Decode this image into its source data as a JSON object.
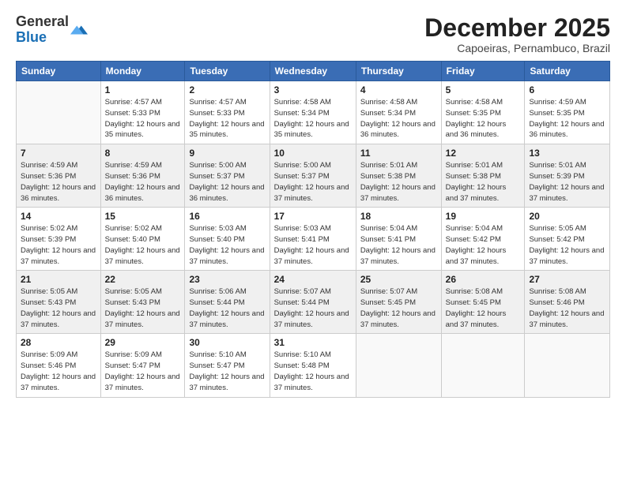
{
  "header": {
    "logo_general": "General",
    "logo_blue": "Blue",
    "month_title": "December 2025",
    "subtitle": "Capoeiras, Pernambuco, Brazil"
  },
  "weekdays": [
    "Sunday",
    "Monday",
    "Tuesday",
    "Wednesday",
    "Thursday",
    "Friday",
    "Saturday"
  ],
  "weeks": [
    [
      {
        "day": "",
        "sunrise": "",
        "sunset": "",
        "daylight": ""
      },
      {
        "day": "1",
        "sunrise": "Sunrise: 4:57 AM",
        "sunset": "Sunset: 5:33 PM",
        "daylight": "Daylight: 12 hours and 35 minutes."
      },
      {
        "day": "2",
        "sunrise": "Sunrise: 4:57 AM",
        "sunset": "Sunset: 5:33 PM",
        "daylight": "Daylight: 12 hours and 35 minutes."
      },
      {
        "day": "3",
        "sunrise": "Sunrise: 4:58 AM",
        "sunset": "Sunset: 5:34 PM",
        "daylight": "Daylight: 12 hours and 35 minutes."
      },
      {
        "day": "4",
        "sunrise": "Sunrise: 4:58 AM",
        "sunset": "Sunset: 5:34 PM",
        "daylight": "Daylight: 12 hours and 36 minutes."
      },
      {
        "day": "5",
        "sunrise": "Sunrise: 4:58 AM",
        "sunset": "Sunset: 5:35 PM",
        "daylight": "Daylight: 12 hours and 36 minutes."
      },
      {
        "day": "6",
        "sunrise": "Sunrise: 4:59 AM",
        "sunset": "Sunset: 5:35 PM",
        "daylight": "Daylight: 12 hours and 36 minutes."
      }
    ],
    [
      {
        "day": "7",
        "sunrise": "Sunrise: 4:59 AM",
        "sunset": "Sunset: 5:36 PM",
        "daylight": "Daylight: 12 hours and 36 minutes."
      },
      {
        "day": "8",
        "sunrise": "Sunrise: 4:59 AM",
        "sunset": "Sunset: 5:36 PM",
        "daylight": "Daylight: 12 hours and 36 minutes."
      },
      {
        "day": "9",
        "sunrise": "Sunrise: 5:00 AM",
        "sunset": "Sunset: 5:37 PM",
        "daylight": "Daylight: 12 hours and 36 minutes."
      },
      {
        "day": "10",
        "sunrise": "Sunrise: 5:00 AM",
        "sunset": "Sunset: 5:37 PM",
        "daylight": "Daylight: 12 hours and 37 minutes."
      },
      {
        "day": "11",
        "sunrise": "Sunrise: 5:01 AM",
        "sunset": "Sunset: 5:38 PM",
        "daylight": "Daylight: 12 hours and 37 minutes."
      },
      {
        "day": "12",
        "sunrise": "Sunrise: 5:01 AM",
        "sunset": "Sunset: 5:38 PM",
        "daylight": "Daylight: 12 hours and 37 minutes."
      },
      {
        "day": "13",
        "sunrise": "Sunrise: 5:01 AM",
        "sunset": "Sunset: 5:39 PM",
        "daylight": "Daylight: 12 hours and 37 minutes."
      }
    ],
    [
      {
        "day": "14",
        "sunrise": "Sunrise: 5:02 AM",
        "sunset": "Sunset: 5:39 PM",
        "daylight": "Daylight: 12 hours and 37 minutes."
      },
      {
        "day": "15",
        "sunrise": "Sunrise: 5:02 AM",
        "sunset": "Sunset: 5:40 PM",
        "daylight": "Daylight: 12 hours and 37 minutes."
      },
      {
        "day": "16",
        "sunrise": "Sunrise: 5:03 AM",
        "sunset": "Sunset: 5:40 PM",
        "daylight": "Daylight: 12 hours and 37 minutes."
      },
      {
        "day": "17",
        "sunrise": "Sunrise: 5:03 AM",
        "sunset": "Sunset: 5:41 PM",
        "daylight": "Daylight: 12 hours and 37 minutes."
      },
      {
        "day": "18",
        "sunrise": "Sunrise: 5:04 AM",
        "sunset": "Sunset: 5:41 PM",
        "daylight": "Daylight: 12 hours and 37 minutes."
      },
      {
        "day": "19",
        "sunrise": "Sunrise: 5:04 AM",
        "sunset": "Sunset: 5:42 PM",
        "daylight": "Daylight: 12 hours and 37 minutes."
      },
      {
        "day": "20",
        "sunrise": "Sunrise: 5:05 AM",
        "sunset": "Sunset: 5:42 PM",
        "daylight": "Daylight: 12 hours and 37 minutes."
      }
    ],
    [
      {
        "day": "21",
        "sunrise": "Sunrise: 5:05 AM",
        "sunset": "Sunset: 5:43 PM",
        "daylight": "Daylight: 12 hours and 37 minutes."
      },
      {
        "day": "22",
        "sunrise": "Sunrise: 5:05 AM",
        "sunset": "Sunset: 5:43 PM",
        "daylight": "Daylight: 12 hours and 37 minutes."
      },
      {
        "day": "23",
        "sunrise": "Sunrise: 5:06 AM",
        "sunset": "Sunset: 5:44 PM",
        "daylight": "Daylight: 12 hours and 37 minutes."
      },
      {
        "day": "24",
        "sunrise": "Sunrise: 5:07 AM",
        "sunset": "Sunset: 5:44 PM",
        "daylight": "Daylight: 12 hours and 37 minutes."
      },
      {
        "day": "25",
        "sunrise": "Sunrise: 5:07 AM",
        "sunset": "Sunset: 5:45 PM",
        "daylight": "Daylight: 12 hours and 37 minutes."
      },
      {
        "day": "26",
        "sunrise": "Sunrise: 5:08 AM",
        "sunset": "Sunset: 5:45 PM",
        "daylight": "Daylight: 12 hours and 37 minutes."
      },
      {
        "day": "27",
        "sunrise": "Sunrise: 5:08 AM",
        "sunset": "Sunset: 5:46 PM",
        "daylight": "Daylight: 12 hours and 37 minutes."
      }
    ],
    [
      {
        "day": "28",
        "sunrise": "Sunrise: 5:09 AM",
        "sunset": "Sunset: 5:46 PM",
        "daylight": "Daylight: 12 hours and 37 minutes."
      },
      {
        "day": "29",
        "sunrise": "Sunrise: 5:09 AM",
        "sunset": "Sunset: 5:47 PM",
        "daylight": "Daylight: 12 hours and 37 minutes."
      },
      {
        "day": "30",
        "sunrise": "Sunrise: 5:10 AM",
        "sunset": "Sunset: 5:47 PM",
        "daylight": "Daylight: 12 hours and 37 minutes."
      },
      {
        "day": "31",
        "sunrise": "Sunrise: 5:10 AM",
        "sunset": "Sunset: 5:48 PM",
        "daylight": "Daylight: 12 hours and 37 minutes."
      },
      {
        "day": "",
        "sunrise": "",
        "sunset": "",
        "daylight": ""
      },
      {
        "day": "",
        "sunrise": "",
        "sunset": "",
        "daylight": ""
      },
      {
        "day": "",
        "sunrise": "",
        "sunset": "",
        "daylight": ""
      }
    ]
  ]
}
